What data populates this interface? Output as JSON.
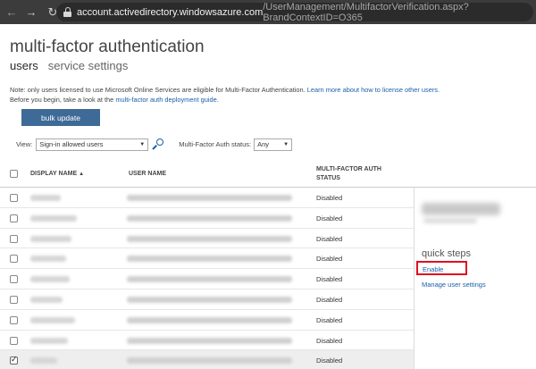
{
  "browser": {
    "url_domain": "account.activedirectory.windowsazure.com",
    "url_path": "/UserManagement/MultifactorVerification.aspx?BrandContextID=O365",
    "back_glyph": "←",
    "forward_glyph": "→",
    "reload_glyph": "↻"
  },
  "header": {
    "title": "multi-factor authentication",
    "tabs": [
      {
        "label": "users"
      },
      {
        "label": "service settings"
      }
    ]
  },
  "notice": {
    "line1_text": "Note: only users licensed to use Microsoft Online Services are eligible for Multi-Factor Authentication. ",
    "line1_link": "Learn more about how to license other users.",
    "line2_text": "Before you begin, take a look at the ",
    "line2_link": "multi-factor auth deployment guide."
  },
  "toolbar": {
    "bulk_update_label": "bulk update"
  },
  "filters": {
    "view_label": "View:",
    "view_value": "Sign-in allowed users",
    "mfa_status_label": "Multi-Factor Auth status:",
    "mfa_status_value": "Any",
    "caret_glyph": "▼"
  },
  "table": {
    "columns": {
      "display_name": "DISPLAY NAME",
      "sort_glyph": "▲",
      "user_name": "USER NAME",
      "mfa_status_line1": "MULTI-FACTOR AUTH",
      "mfa_status_line2": "STATUS"
    },
    "rows": [
      {
        "status": "Disabled",
        "checked": false
      },
      {
        "status": "Disabled",
        "checked": false
      },
      {
        "status": "Disabled",
        "checked": false
      },
      {
        "status": "Disabled",
        "checked": false
      },
      {
        "status": "Disabled",
        "checked": false
      },
      {
        "status": "Disabled",
        "checked": false
      },
      {
        "status": "Disabled",
        "checked": false
      },
      {
        "status": "Disabled",
        "checked": false
      },
      {
        "status": "Disabled",
        "checked": true
      }
    ]
  },
  "side_panel": {
    "quick_steps_title": "quick steps",
    "enable_label": "Enable",
    "manage_label": "Manage user settings"
  },
  "colors": {
    "accent_link": "#1a5fa8",
    "button_bg": "#3d6a96",
    "highlight_box": "#e01020"
  }
}
